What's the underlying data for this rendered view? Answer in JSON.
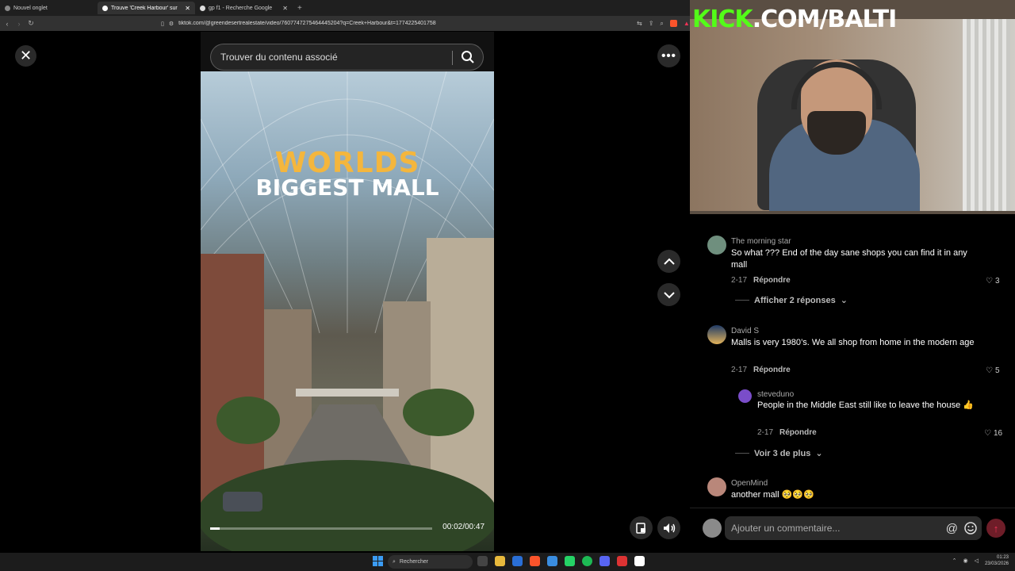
{
  "browser": {
    "tabs": [
      {
        "label": "Nouvel onglet",
        "active": false
      },
      {
        "label": "Trouve 'Creek Harbour' sur TikTok",
        "active": true
      },
      {
        "label": "gp f1 - Recherche Google",
        "active": false
      }
    ],
    "new_tab": "+",
    "url": "tiktok.com/@greendesertrealestate/video/7607747275464445204?q=Creek+Harbour&t=1774225401758"
  },
  "video": {
    "search_placeholder": "Trouver du contenu associé",
    "title_line1": "WORLDS",
    "title_line2": "BIGGEST MALL",
    "time": "00:02/00:47",
    "progress": 0.043
  },
  "overlay": {
    "kick_green": "KICK",
    "kick_white": ".COM/BALTI"
  },
  "comments": [
    {
      "name": "The morning star",
      "text": "So what ??? End of the day sane shops you can find it in any mall",
      "date": "2-17",
      "reply": "Répondre",
      "likes": "3",
      "more": "Afficher 2 réponses"
    },
    {
      "name": "David S",
      "text": "Malls is very 1980’s. We all shop from home in the modern age",
      "date": "2-17",
      "reply": "Répondre",
      "likes": "5"
    },
    {
      "name": "steveduno",
      "text": "People in the Middle East still like to leave the house 👍",
      "date": "2-17",
      "reply": "Répondre",
      "likes": "16",
      "more": "Voir 3 de plus"
    },
    {
      "name": "OpenMind",
      "text": "another mall 🥺🥺🥺"
    }
  ],
  "composer": {
    "placeholder": "Ajouter un commentaire...",
    "mention": "@"
  },
  "taskbar": {
    "search": "Rechercher",
    "time": "01:23",
    "date": "23/03/2026"
  },
  "colors": {
    "kick_green": "#53fc18",
    "title_gold": "#f4b63d",
    "send_red": "#6e1d28"
  }
}
